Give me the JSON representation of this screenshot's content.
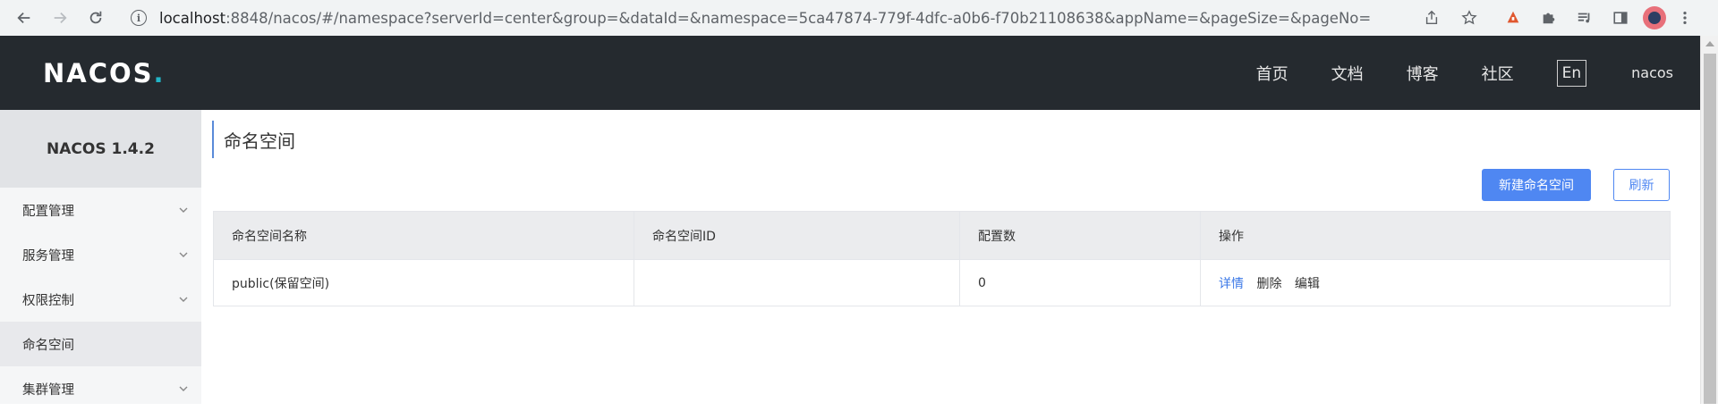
{
  "browser": {
    "url_host": "localhost",
    "url_rest": ":8848/nacos/#/namespace?serverId=center&group=&dataId=&namespace=5ca47874-779f-4dfc-a0b6-f70b21108638&appName=&pageSize=&pageNo=",
    "icons": [
      "back-arrow-icon",
      "forward-arrow-icon",
      "reload-icon",
      "site-info-icon",
      "share-icon",
      "star-icon",
      "extension-fire-icon",
      "puzzle-icon",
      "playlist-icon",
      "side-panel-icon",
      "profile-avatar-icon",
      "more-menu-icon"
    ]
  },
  "header": {
    "logo": "NACOS",
    "nav": [
      "首页",
      "文档",
      "博客",
      "社区"
    ],
    "lang": "En",
    "user": "nacos",
    "colors": {
      "background": "#252a2f",
      "logo_accent": "#22b5c7"
    }
  },
  "sidebar": {
    "title": "NACOS 1.4.2",
    "items": [
      {
        "label": "配置管理",
        "expandable": true
      },
      {
        "label": "服务管理",
        "expandable": true
      },
      {
        "label": "权限控制",
        "expandable": true
      },
      {
        "label": "命名空间",
        "expandable": false,
        "active": true
      },
      {
        "label": "集群管理",
        "expandable": true
      }
    ]
  },
  "main": {
    "title": "命名空间",
    "buttons": {
      "create": "新建命名空间",
      "refresh": "刷新"
    },
    "table": {
      "columns": [
        "命名空间名称",
        "命名空间ID",
        "配置数",
        "操作"
      ],
      "rows": [
        {
          "name": "public(保留空间)",
          "id": "",
          "count": "0",
          "ops": [
            "详情",
            "删除",
            "编辑"
          ]
        }
      ]
    },
    "colors": {
      "primary": "#4f87f2",
      "link": "#3b78e7"
    }
  }
}
